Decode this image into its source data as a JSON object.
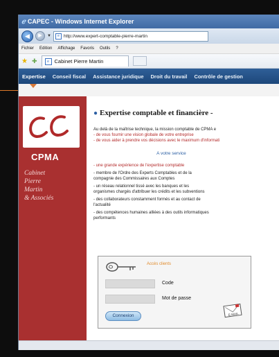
{
  "browser": {
    "title": "CAPEC - Windows Internet Explorer",
    "address": "http://www.expert-comptable-pierre-martin",
    "menu": [
      "Fichier",
      "Edition",
      "Affichage",
      "Favoris",
      "Outils",
      "?"
    ],
    "tab_title": "Cabinet Pierre Martin"
  },
  "site_nav": [
    "Expertise",
    "Conseil fiscal",
    "Assistance juridique",
    "Droit du travail",
    "Contrôle de gestion"
  ],
  "sidebar": {
    "brand": "CPMA",
    "firm_lines": [
      "Cabinet",
      "Pierre",
      "Martin",
      "& Associés"
    ]
  },
  "content": {
    "heading": "Expertise comptable et financière -",
    "intro": [
      "Au delà de la maîtrise technique, la mission comptable de CPMA e",
      "- de vous fournir une vision globale de votre entreprise",
      "- de vous aider à prendre vos décisions avec le maximum d'informati"
    ],
    "service_title": "A votre service",
    "services": [
      [
        "- une grande expérience de l'expertise comptable"
      ],
      [
        "- membre de l'Ordre des Experts Comptables et de la",
        "compagnie des Commissaires aux Comptes"
      ],
      [
        "- un réseau relationnel tissé avec les banques et les",
        "organismes chargés d'attribuer les crédits et les subventions"
      ],
      [
        "- des collaborateurs constamment formés et au contact de",
        "l'actualité"
      ],
      [
        "- des compétences humaines alliées à des outils informatiques",
        "performants"
      ]
    ]
  },
  "login": {
    "title": "Accès clients",
    "code_label": "Code",
    "password_label": "Mot de passe",
    "connect_button": "Connexion",
    "email_label": "E-MAIL"
  },
  "colors": {
    "sidebar": "#a93030",
    "nav": "#1d477a",
    "accent_orange": "#e08a2a",
    "link_blue": "#2b5fa3"
  }
}
